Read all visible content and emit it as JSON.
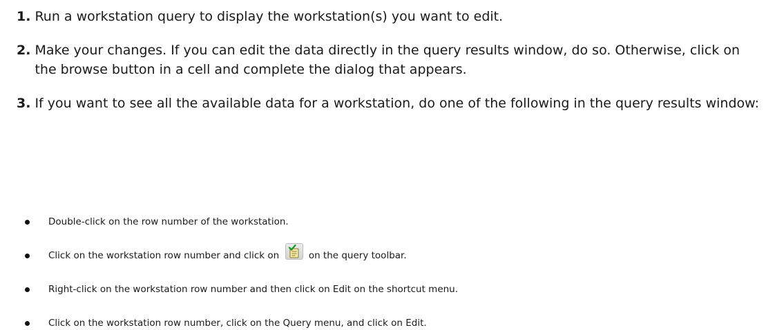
{
  "steps": [
    {
      "number": "1.",
      "text": "Run a workstation query to display the workstation(s) you want to edit."
    },
    {
      "number": "2.",
      "text": "Make your changes. If you can edit the data directly in the query results window, do so. Otherwise, click on the browse button in a cell and complete the dialog that appears."
    },
    {
      "number": "3.",
      "text": "If you want to see all the available data for a workstation, do one of the following in the query results window:"
    }
  ],
  "bullets": {
    "item1": "Double-click on the row number of the workstation.",
    "item2_before": "Click on the workstation row number and click on",
    "item2_icon": "edit-record-icon",
    "item2_after": "on the query toolbar.",
    "item3": "Right-click on the workstation row number and then click on Edit on the shortcut menu.",
    "item4": "Click on the workstation row number, click on the Query menu, and click on Edit."
  }
}
